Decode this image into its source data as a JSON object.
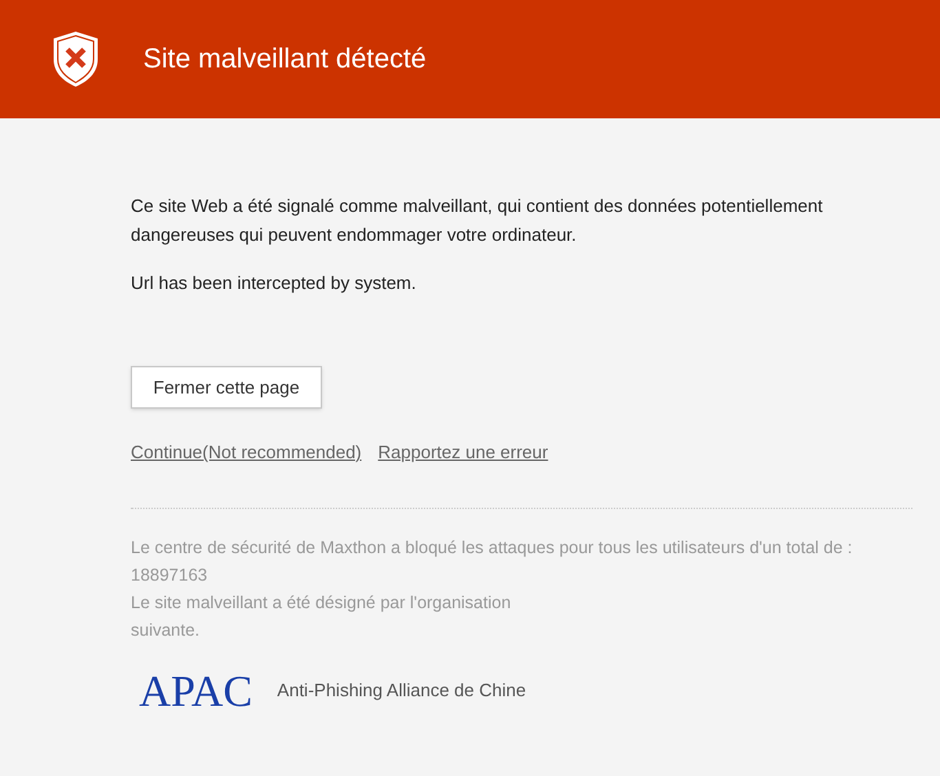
{
  "header": {
    "title": "Site malveillant détecté"
  },
  "warning": [
    "Ce site Web a été signalé comme malveillant, qui contient des données potentiellement dangereuses qui peuvent endommager votre ordinateur.",
    "Url has been intercepted by system."
  ],
  "close_button": "Fermer cette page",
  "links": [
    "Continue(Not recommended)",
    "Rapportez une erreur"
  ],
  "stats": {
    "text": "Le centre de sécurité de Maxthon a bloqué les attaques pour tous les utilisateurs d'un total de :",
    "count": "18897163"
  },
  "designation": "Le site malveillant a été désigné par l'organisation suivante.",
  "organization": {
    "logo": "APAC",
    "name": "Anti-Phishing Alliance de Chine"
  }
}
